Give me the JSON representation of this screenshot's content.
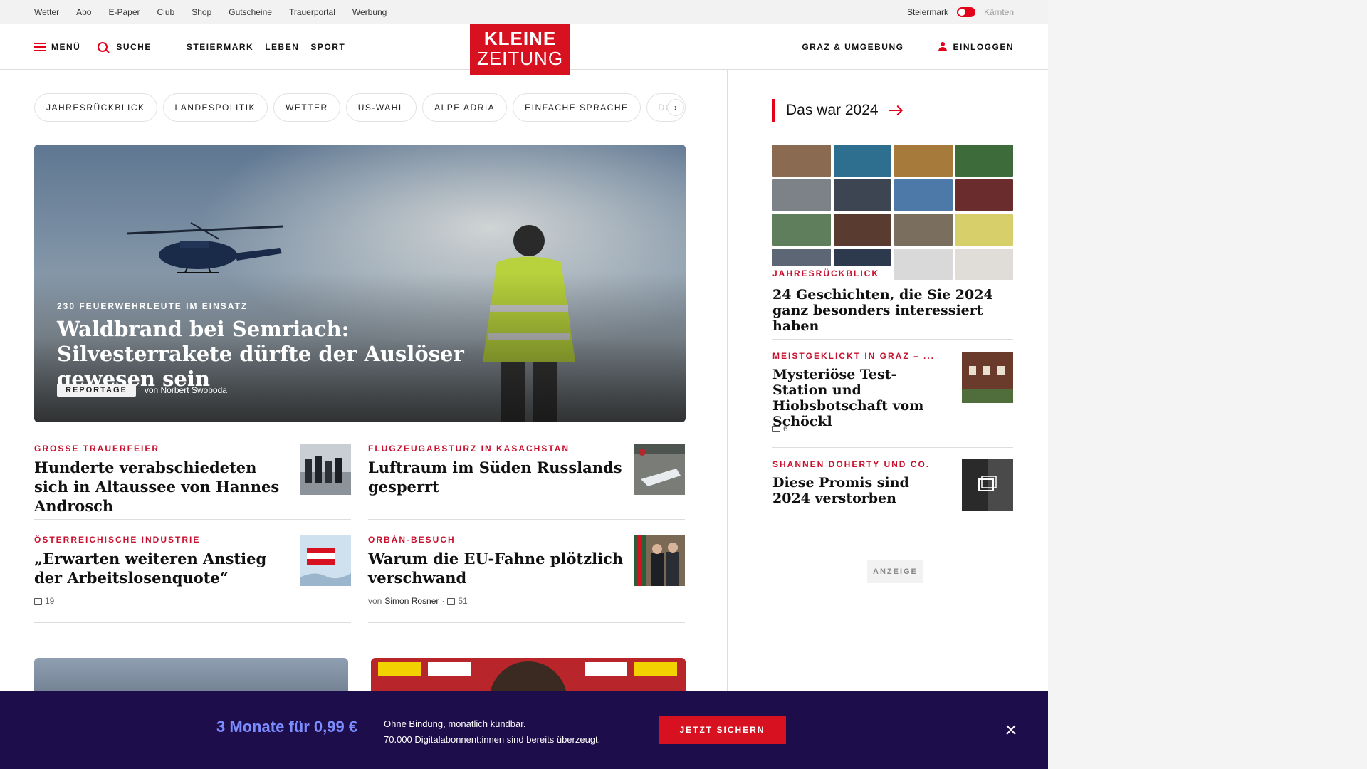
{
  "utility": {
    "links": [
      "Wetter",
      "Abo",
      "E-Paper",
      "Club",
      "Shop",
      "Gutscheine",
      "Trauerportal",
      "Werbung"
    ],
    "region_active": "Steiermark",
    "region_inactive": "Kärnten"
  },
  "header": {
    "menu_label": "MENÜ",
    "search_label": "SUCHE",
    "nav": [
      "STEIERMARK",
      "LEBEN",
      "SPORT"
    ],
    "logo_line1": "KLEINE",
    "logo_line2": "ZEITUNG",
    "region_link": "GRAZ & UMGEBUNG",
    "login_label": "EINLOGGEN"
  },
  "chips": [
    "JAHRESRÜCKBLICK",
    "LANDESPOLITIK",
    "WETTER",
    "US-WAHL",
    "ALPE ADRIA",
    "EINFACHE SPRACHE",
    "DO"
  ],
  "hero": {
    "kicker": "230 FEUERWEHRLEUTE IM EINSATZ",
    "title": "Waldbrand bei Semriach: Silvesterrakete dürfte der Auslöser gewesen sein",
    "tag": "REPORTAGE",
    "byline": "von Norbert Swoboda"
  },
  "articles": [
    {
      "kicker": "GROSSE TRAUERFEIER",
      "title": "Hunderte verabschiedeten sich in Altaussee von Hannes Androsch"
    },
    {
      "kicker": "FLUGZEUGABSTURZ IN KASACHSTAN",
      "title": "Luftraum im Süden Russlands gesperrt"
    },
    {
      "kicker": "ÖSTERREICHISCHE INDUSTRIE",
      "title": "„Erwarten weiteren Anstieg der Arbeitslosenquote“",
      "comments": "19"
    },
    {
      "kicker": "ORBÁN-BESUCH",
      "title": "Warum die EU-Fahne plötzlich verschwand",
      "by_prefix": "von",
      "author": "Simon Rosner",
      "comments": "51"
    }
  ],
  "sidebar": {
    "year_heading": "Das war 2024",
    "feature_kicker": "JAHRESRÜCKBLICK",
    "feature_title": "24 Geschichten, die Sie 2024 ganz besonders interessiert haben",
    "item1_kicker": "MEISTGEKLICKT IN GRAZ – ...",
    "item1_title": "Mysteriöse Test-Station und Hiobsbotschaft vom Schöckl",
    "item1_comments": "6",
    "item2_kicker": "SHANNEN DOHERTY UND CO.",
    "item2_title": "Diese Promis sind 2024 verstorben",
    "ad_label": "ANZEIGE"
  },
  "promo": {
    "price": "3 Monate für 0,99 €",
    "line1": "Ohne Bindung, monatlich kündbar.",
    "line2": "70.000 Digitalabonnent:innen sind bereits überzeugt.",
    "cta": "JETZT SICHERN"
  },
  "colors": {
    "brand_red": "#d7111f",
    "kicker_red": "#c8102e",
    "promo_bg": "#1d0d4a",
    "promo_price": "#7b8cff"
  }
}
